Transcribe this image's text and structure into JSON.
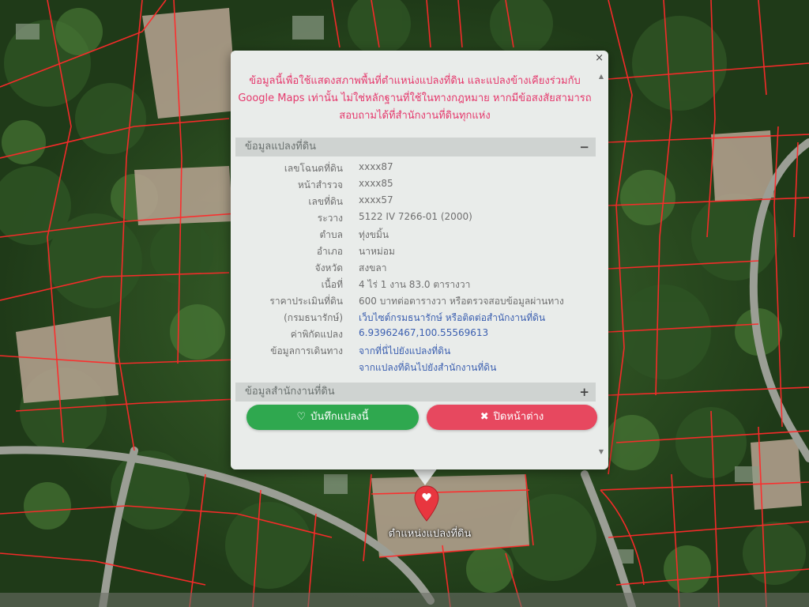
{
  "popup": {
    "close_symbol": "×",
    "disclaimer_line1": "ข้อมูลนี้เพื่อใช้แสดงสภาพพื้นที่ตำแหน่งแปลงที่ดิน และแปลงข้างเคียงร่วมกับ",
    "disclaimer_line2": "Google Maps เท่านั้น ไม่ใช่หลักฐานที่ใช้ในทางกฎหมาย หากมีข้อสงสัยสามารถ",
    "disclaimer_line3": "สอบถามได้ที่สำนักงานที่ดินทุกแห่ง",
    "parcel_section_title": "ข้อมูลแปลงที่ดิน",
    "parcel_section_toggle": "−",
    "office_section_title": "ข้อมูลสำนักงานที่ดิน",
    "office_section_toggle": "+",
    "rows": [
      {
        "label": "เลขโฉนดที่ดิน",
        "value": "xxxx87"
      },
      {
        "label": "หน้าสำรวจ",
        "value": "xxxx85"
      },
      {
        "label": "เลขที่ดิน",
        "value": "xxxx57"
      },
      {
        "label": "ระวาง",
        "value": "5122 IV 7266-01 (2000)"
      },
      {
        "label": "ตำบล",
        "value": "ทุ่งขมิ้น"
      },
      {
        "label": "อำเภอ",
        "value": "นาหม่อม"
      },
      {
        "label": "จังหวัด",
        "value": "สงขลา"
      },
      {
        "label": "เนื้อที่",
        "value": "4 ไร่ 1 งาน 83.0 ตารางวา"
      },
      {
        "label": "ราคาประเมินที่ดิน",
        "value": "600 บาทต่อตารางวา หรือตรวจสอบข้อมูลผ่านทาง"
      },
      {
        "label": "(กรมธนารักษ์)",
        "value": "เว็บไซต์กรมธนารักษ์ หรือติดต่อสำนักงานที่ดิน"
      },
      {
        "label": "ค่าพิกัดแปลง",
        "value": "6.93962467,100.55569613"
      },
      {
        "label": "ข้อมูลการเดินทาง",
        "value": "จากที่นี่ไปยังแปลงที่ดิน"
      },
      {
        "label": "",
        "value": "จากแปลงที่ดินไปยังสำนักงานที่ดิน"
      }
    ],
    "save_button": "บันทึกแปลงนี้",
    "close_button": "ปิดหน้าต่าง",
    "save_icon": "heart-icon",
    "close_icon": "x-icon"
  },
  "map": {
    "marker_label": "ตำแหน่งแปลงที่ดิน",
    "parcel_line_color": "#ff2a2a",
    "marker_color": "#e8363f"
  },
  "colors": {
    "disclaimer": "#e5386c",
    "save_button": "#2fa84f",
    "close_button": "#e7485f",
    "link": "#3b5fb0"
  }
}
